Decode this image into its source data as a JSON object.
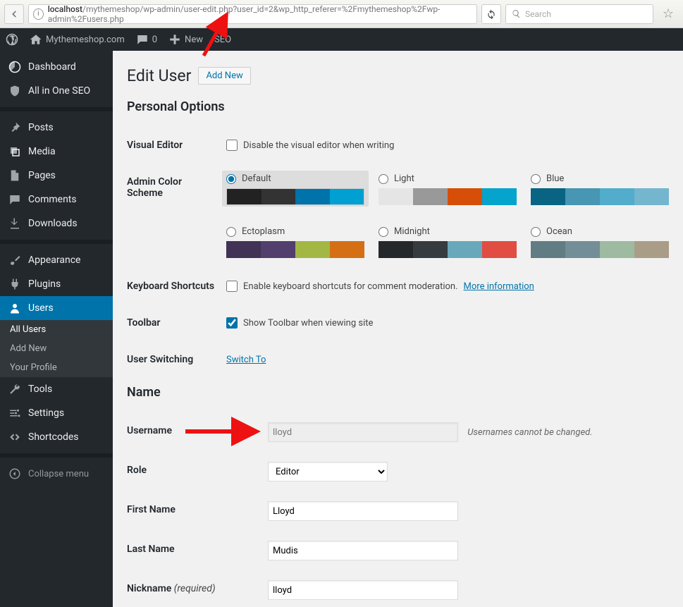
{
  "browser": {
    "url_host": "localhost",
    "url_path": "/mythemeshop/wp-admin/user-edit.php?user_id=2&wp_http_referer=%2Fmythemeshop%2Fwp-admin%2Fusers.php",
    "search_placeholder": "Search"
  },
  "toolbar": {
    "site_name": "Mythemeshop.com",
    "comments_count": "0",
    "new_label": "New",
    "seo_label": "SEO"
  },
  "menu": {
    "items": [
      {
        "icon": "dashboard",
        "label": "Dashboard"
      },
      {
        "icon": "shield",
        "label": "All in One SEO"
      },
      {
        "icon": "pin",
        "label": "Posts",
        "sep_before": true
      },
      {
        "icon": "media",
        "label": "Media"
      },
      {
        "icon": "page",
        "label": "Pages"
      },
      {
        "icon": "comment",
        "label": "Comments"
      },
      {
        "icon": "download",
        "label": "Downloads"
      },
      {
        "icon": "brush",
        "label": "Appearance",
        "sep_before": true
      },
      {
        "icon": "plug",
        "label": "Plugins"
      },
      {
        "icon": "user",
        "label": "Users",
        "current": true,
        "submenu": [
          {
            "label": "All Users",
            "active": true
          },
          {
            "label": "Add New"
          },
          {
            "label": "Your Profile"
          }
        ]
      },
      {
        "icon": "wrench",
        "label": "Tools"
      },
      {
        "icon": "sliders",
        "label": "Settings"
      },
      {
        "icon": "code",
        "label": "Shortcodes"
      }
    ],
    "collapse_label": "Collapse menu"
  },
  "page": {
    "title": "Edit User",
    "add_new": "Add New",
    "section_personal": "Personal Options",
    "section_name": "Name",
    "rows": {
      "visual_editor": {
        "label": "Visual Editor",
        "check_label": "Disable the visual editor when writing",
        "checked": false
      },
      "color_scheme": {
        "label": "Admin Color Scheme"
      },
      "shortcuts": {
        "label": "Keyboard Shortcuts",
        "check_label": "Enable keyboard shortcuts for comment moderation.",
        "more": "More information",
        "checked": false
      },
      "toolbar_row": {
        "label": "Toolbar",
        "check_label": "Show Toolbar when viewing site",
        "checked": true
      },
      "switching": {
        "label": "User Switching",
        "link": "Switch To"
      },
      "username": {
        "label": "Username",
        "value": "lloyd",
        "note": "Usernames cannot be changed."
      },
      "role": {
        "label": "Role",
        "value": "Editor"
      },
      "first_name": {
        "label": "First Name",
        "value": "Lloyd"
      },
      "last_name": {
        "label": "Last Name",
        "value": "Mudis"
      },
      "nickname": {
        "label": "Nickname",
        "required": "(required)",
        "value": "lloyd"
      }
    },
    "schemes": [
      {
        "name": "Default",
        "selected": true,
        "colors": [
          "#222222",
          "#333333",
          "#0073aa",
          "#00a0d2"
        ]
      },
      {
        "name": "Light",
        "selected": false,
        "colors": [
          "#e5e5e5",
          "#999999",
          "#d64e07",
          "#04a4cc"
        ]
      },
      {
        "name": "Blue",
        "selected": false,
        "colors": [
          "#096484",
          "#4796b3",
          "#52accc",
          "#74b6ce"
        ]
      },
      {
        "name": "Ectoplasm",
        "selected": false,
        "colors": [
          "#413256",
          "#523f6d",
          "#a3b745",
          "#d46f15"
        ]
      },
      {
        "name": "Midnight",
        "selected": false,
        "colors": [
          "#25282b",
          "#363b3f",
          "#69a8bb",
          "#e14d43"
        ]
      },
      {
        "name": "Ocean",
        "selected": false,
        "colors": [
          "#627c83",
          "#738e96",
          "#9ebaa0",
          "#aa9d88"
        ]
      }
    ]
  }
}
